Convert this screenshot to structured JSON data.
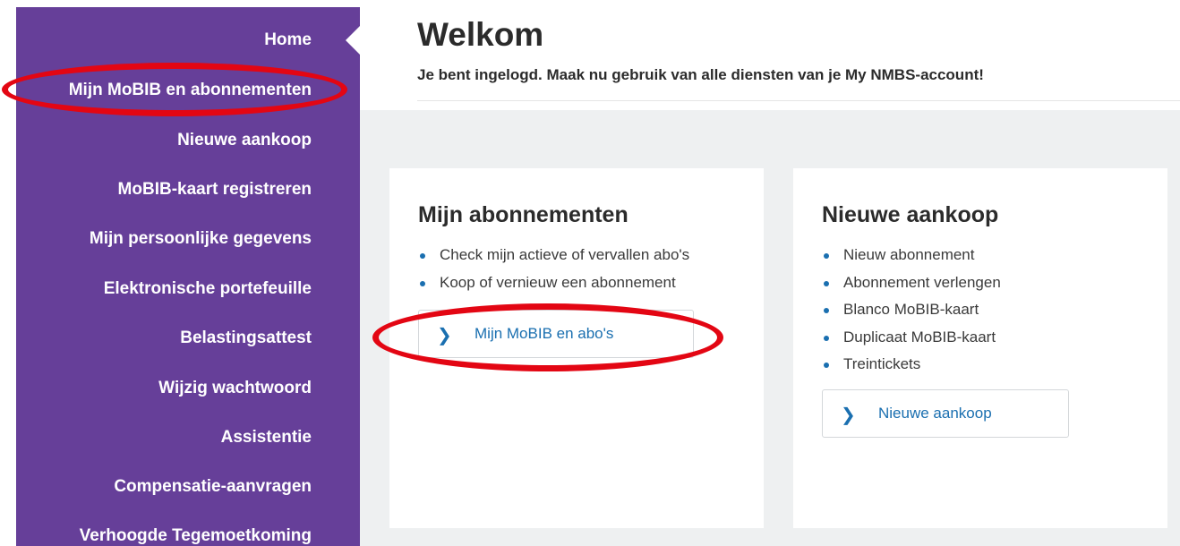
{
  "sidebar": {
    "items": [
      {
        "label": "Home"
      },
      {
        "label": "Mijn MoBIB en abonnementen"
      },
      {
        "label": "Nieuwe aankoop"
      },
      {
        "label": "MoBIB-kaart registreren"
      },
      {
        "label": "Mijn persoonlijke gegevens"
      },
      {
        "label": "Elektronische portefeuille"
      },
      {
        "label": "Belastingsattest"
      },
      {
        "label": "Wijzig wachtwoord"
      },
      {
        "label": "Assistentie"
      },
      {
        "label": "Compensatie-aanvragen"
      },
      {
        "label": "Verhoogde Tegemoetkoming"
      }
    ]
  },
  "header": {
    "title": "Welkom",
    "subtitle": "Je bent ingelogd. Maak nu gebruik van alle diensten van je My NMBS-account!"
  },
  "cards": [
    {
      "title": "Mijn abonnementen",
      "bullets": [
        "Check mijn actieve of vervallen abo's",
        "Koop of vernieuw een abonnement"
      ],
      "button_label": "Mijn MoBIB en abo's"
    },
    {
      "title": "Nieuwe aankoop",
      "bullets": [
        "Nieuw abonnement",
        "Abonnement verlengen",
        "Blanco MoBIB-kaart",
        "Duplicaat MoBIB-kaart",
        "Treintickets"
      ],
      "button_label": "Nieuwe aankoop"
    }
  ],
  "colors": {
    "sidebar": "#663f99",
    "link": "#1a6fb0",
    "annotation": "#e30613",
    "content_bg": "#eef0f1"
  },
  "icons": {
    "button_chevron": "chevron-right-icon"
  }
}
